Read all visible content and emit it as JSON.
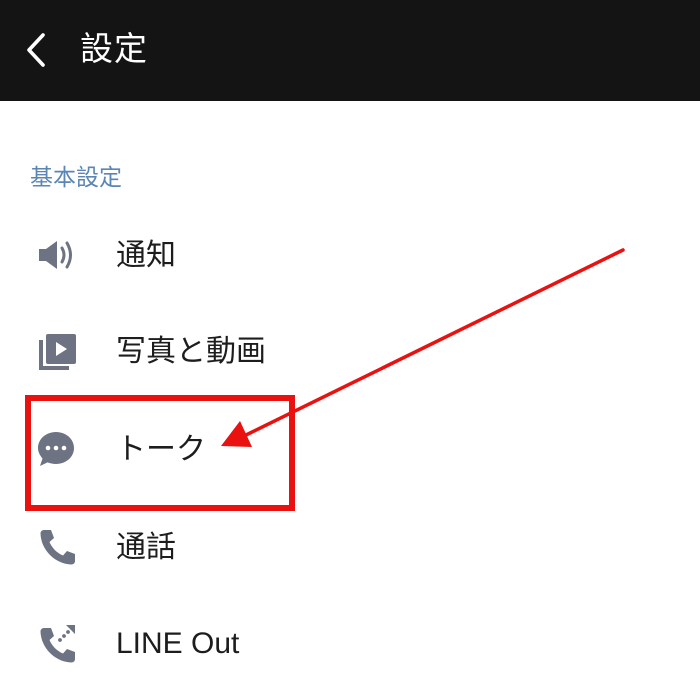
{
  "app_bar": {
    "title": "設定",
    "back_icon": "chevron-left-icon"
  },
  "section": {
    "title": "基本設定"
  },
  "menu": {
    "items": [
      {
        "label": "通知",
        "icon": "speaker-icon"
      },
      {
        "label": "写真と動画",
        "icon": "media-play-icon"
      },
      {
        "label": "トーク",
        "icon": "chat-bubble-icon"
      },
      {
        "label": "通話",
        "icon": "phone-icon"
      },
      {
        "label": "LINE Out",
        "icon": "phone-outgoing-icon"
      }
    ]
  },
  "annotation": {
    "highlighted_item": "トーク",
    "color": "#ea1111"
  },
  "colors": {
    "app_bar": "#141414",
    "section_header": "#5b86b4",
    "icon": "#6e7384",
    "label": "#1d1d1d"
  }
}
